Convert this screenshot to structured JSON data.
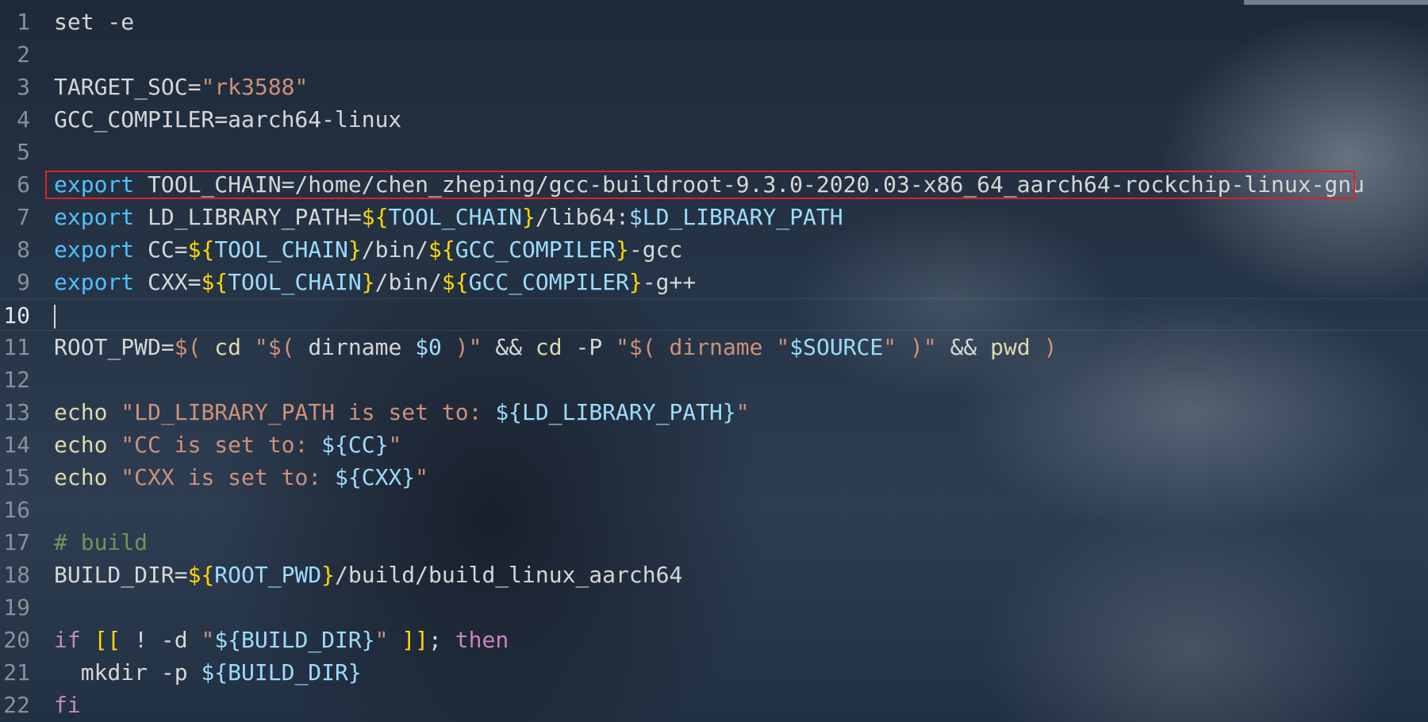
{
  "editor": {
    "current_line": "10",
    "highlight_color": "#e02020",
    "lines": [
      {
        "n": "1",
        "t": [
          "set -e"
        ]
      },
      {
        "n": "2",
        "t": []
      },
      {
        "n": "3",
        "t": [
          "TARGET_SOC=",
          "\"rk3588\""
        ]
      },
      {
        "n": "4",
        "t": [
          "GCC_COMPILER=aarch64-linux"
        ]
      },
      {
        "n": "5",
        "t": []
      },
      {
        "n": "6",
        "t": [
          "export",
          " TOOL_CHAIN=/home/chen_zheping/gcc-buildroot-9.3.0-2020.03-x86_64_aarch64-rockchip-linux-gnu"
        ]
      },
      {
        "n": "7",
        "t": [
          "export",
          " LD_LIBRARY_PATH=",
          "${",
          "TOOL_CHAIN",
          "}",
          "/lib64:",
          "$LD_LIBRARY_PATH"
        ]
      },
      {
        "n": "8",
        "t": [
          "export",
          " CC=",
          "${",
          "TOOL_CHAIN",
          "}",
          "/bin/",
          "${",
          "GCC_COMPILER",
          "}",
          "-gcc"
        ]
      },
      {
        "n": "9",
        "t": [
          "export",
          " CXX=",
          "${",
          "TOOL_CHAIN",
          "}",
          "/bin/",
          "${",
          "GCC_COMPILER",
          "}",
          "-g++"
        ]
      },
      {
        "n": "10",
        "t": []
      },
      {
        "n": "11",
        "t": [
          "ROOT_PWD=",
          "$(",
          " ",
          "cd",
          " ",
          "\"$(",
          " ",
          "dirname",
          " ",
          "$0",
          " ",
          ")\"",
          " ",
          "&&",
          " ",
          "cd",
          " ",
          "-P",
          " ",
          "\"$(",
          " ",
          "dirname",
          " ",
          "\"",
          "$SOURCE",
          "\"",
          " ",
          ")\"",
          " ",
          "&&",
          " ",
          "pwd",
          " ",
          ")"
        ]
      },
      {
        "n": "12",
        "t": []
      },
      {
        "n": "13",
        "t": [
          "echo",
          " ",
          "\"LD_LIBRARY_PATH is set to: ",
          "${LD_LIBRARY_PATH}",
          "\""
        ]
      },
      {
        "n": "14",
        "t": [
          "echo",
          " ",
          "\"CC is set to: ",
          "${CC}",
          "\""
        ]
      },
      {
        "n": "15",
        "t": [
          "echo",
          " ",
          "\"CXX is set to: ",
          "${CXX}",
          "\""
        ]
      },
      {
        "n": "16",
        "t": []
      },
      {
        "n": "17",
        "t": [
          "# build"
        ]
      },
      {
        "n": "18",
        "t": [
          "BUILD_DIR=",
          "${",
          "ROOT_PWD",
          "}",
          "/build/build_linux_aarch64"
        ]
      },
      {
        "n": "19",
        "t": []
      },
      {
        "n": "20",
        "t": [
          "if",
          " ",
          "[[",
          " ! -d ",
          "\"",
          "${BUILD_DIR}",
          "\"",
          " ",
          "]]",
          "; ",
          "then"
        ]
      },
      {
        "n": "21",
        "t": [
          "  mkdir -p ",
          "${BUILD_DIR}"
        ]
      },
      {
        "n": "22",
        "t": [
          "fi"
        ]
      }
    ]
  }
}
